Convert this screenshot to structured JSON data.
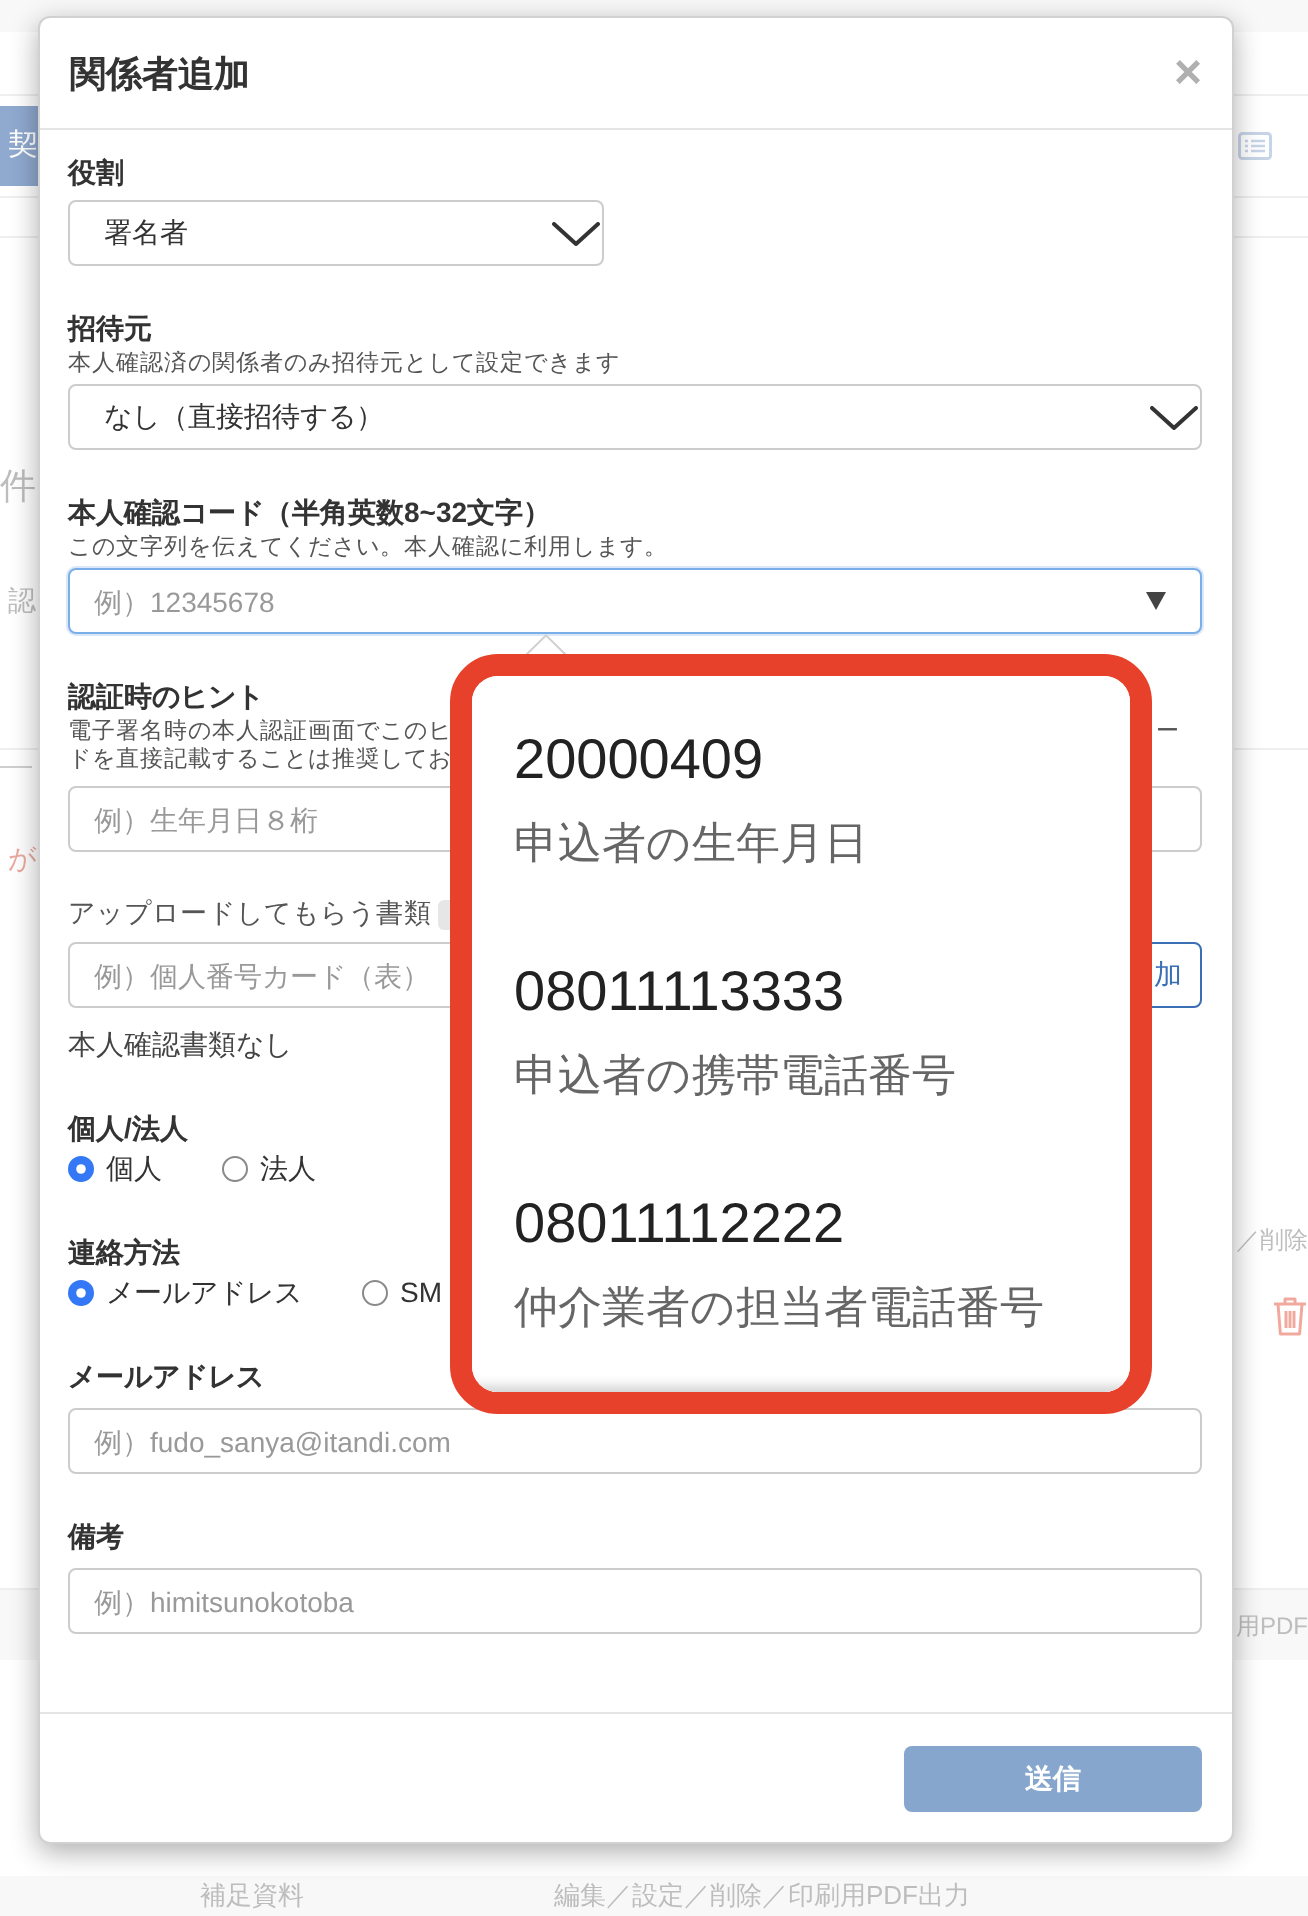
{
  "background_page": {
    "button": "契",
    "left_texts": [
      {
        "text": "件",
        "kind": "heading"
      },
      {
        "text": "認",
        "kind": "plain"
      },
      {
        "text": "が",
        "kind": "warning"
      }
    ],
    "right_texts": [
      "／削除",
      "用PDF"
    ],
    "bottom_texts": [
      "補足資料",
      "編集／設定／削除／印刷用PDF出力"
    ]
  },
  "modal": {
    "title": "関係者追加",
    "close": "×",
    "fields": [
      {
        "kind": "compact_select",
        "label": "役割",
        "value": "署名者"
      },
      {
        "kind": "select",
        "label": "招待元",
        "help": "本人確認済の関係者のみ招待元として設定できます",
        "value": "なし（直接招待する）"
      },
      {
        "kind": "code_input",
        "label": "本人確認コード（半角英数8~32文字）",
        "help": "この文字列を伝えてください。本人確認に利用します。",
        "placeholder": "例）12345678",
        "focused": true,
        "suggestions": {
          "highlighted": true,
          "items": [
            {
              "value": "20000409",
              "description": "申込者の生年月日"
            },
            {
              "value": "08011113333",
              "description": "申込者の携帯電話番号"
            },
            {
              "value": "08011112222",
              "description": "仲介業者の担当者電話番号"
            }
          ]
        }
      },
      {
        "kind": "text_input",
        "label": "認証時のヒント",
        "help_lines": [
          {
            "left": "電子署名時の本人認証画面でこのヒ",
            "right": "ー"
          },
          {
            "left": "ドを直接記載することは推奨してお"
          }
        ],
        "placeholder": "例）生年月日８桁"
      },
      {
        "kind": "upload",
        "label": "アップロードしてもらう書類",
        "placeholder": "例）個人番号カード（表）",
        "button": "加",
        "note": "本人確認書類なし"
      },
      {
        "kind": "radio",
        "label": "個人/法人",
        "options": [
          {
            "label": "個人",
            "selected": true
          },
          {
            "label": "法人",
            "selected": false
          }
        ]
      },
      {
        "kind": "radio",
        "label": "連絡方法",
        "options": [
          {
            "label": "メールアドレス",
            "selected": true
          },
          {
            "label": "SM",
            "selected": false
          }
        ]
      },
      {
        "kind": "text_input",
        "label": "メールアドレス",
        "placeholder": "例）fudo_sanya@itandi.com"
      },
      {
        "kind": "text_input",
        "label": "備考",
        "placeholder": "例）himitsunokotoba"
      }
    ],
    "submit": {
      "label": "送信",
      "disabled": true
    }
  }
}
